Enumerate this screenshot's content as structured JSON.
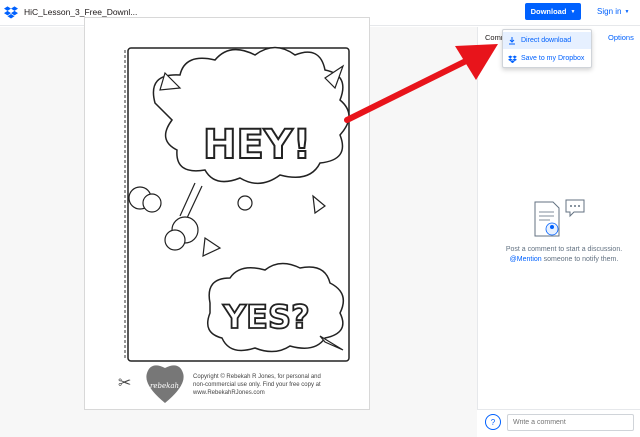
{
  "header": {
    "filename": "HiC_Lesson_3_Free_Downl...",
    "download_label": "Download",
    "signin_label": "Sign in"
  },
  "sidebar": {
    "tab_comments": "Comm",
    "tab_options": "Options",
    "empty_text_1": "Post a comment to start a discussion.",
    "empty_mention": "@Mention",
    "empty_text_2": " someone to notify them.",
    "comment_placeholder": "Write a comment",
    "help_label": "?"
  },
  "dropdown": {
    "items": [
      {
        "label": "Direct download",
        "icon": "download-icon"
      },
      {
        "label": "Save to my Dropbox",
        "icon": "dropbox-icon"
      }
    ]
  },
  "document": {
    "bubble_1_text": "HEY!",
    "bubble_2_text": "YES?",
    "logo_text": "rebekah r jones",
    "copyright": [
      "Copyright © Rebekah R Jones, for personal and",
      "non-commercial use only. Find your free copy at",
      "www.RebekahRJones.com"
    ]
  },
  "colors": {
    "accent": "#0061fe",
    "annotation_arrow": "#e8141b"
  }
}
